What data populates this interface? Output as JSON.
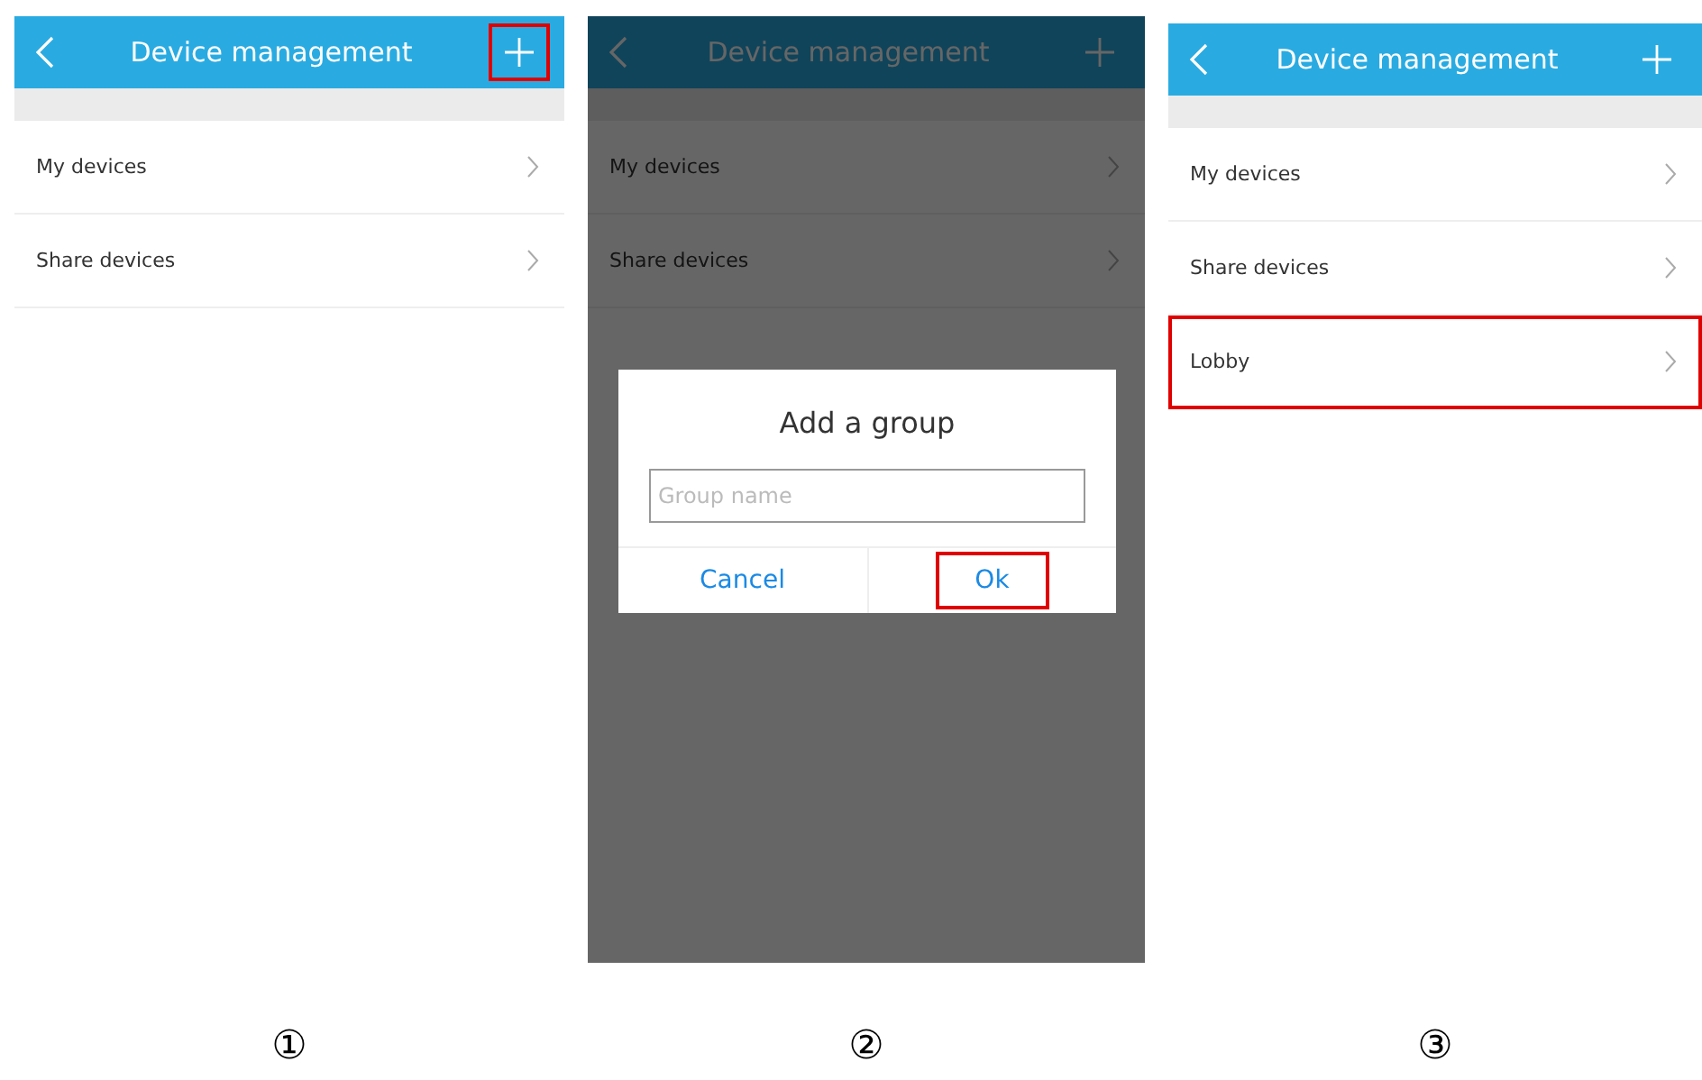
{
  "screens": [
    {
      "step": "①",
      "dimmed": false,
      "title": "Device management",
      "add_highlighted": true,
      "items": [
        {
          "label": "My devices",
          "highlighted": false
        },
        {
          "label": "Share devices",
          "highlighted": false
        }
      ]
    },
    {
      "step": "②",
      "dimmed": true,
      "title": "Device management",
      "add_highlighted": false,
      "items": [
        {
          "label": "My devices",
          "highlighted": false
        },
        {
          "label": "Share devices",
          "highlighted": false
        }
      ],
      "dialog": {
        "title": "Add a group",
        "placeholder": "Group name",
        "buttons": [
          {
            "label": "Cancel",
            "highlighted": false
          },
          {
            "label": "Ok",
            "highlighted": true
          }
        ]
      }
    },
    {
      "step": "③",
      "dimmed": false,
      "title": "Device management",
      "add_highlighted": false,
      "items": [
        {
          "label": "My devices",
          "highlighted": false
        },
        {
          "label": "Share devices",
          "highlighted": false
        },
        {
          "label": "Lobby",
          "highlighted": true
        }
      ]
    }
  ]
}
